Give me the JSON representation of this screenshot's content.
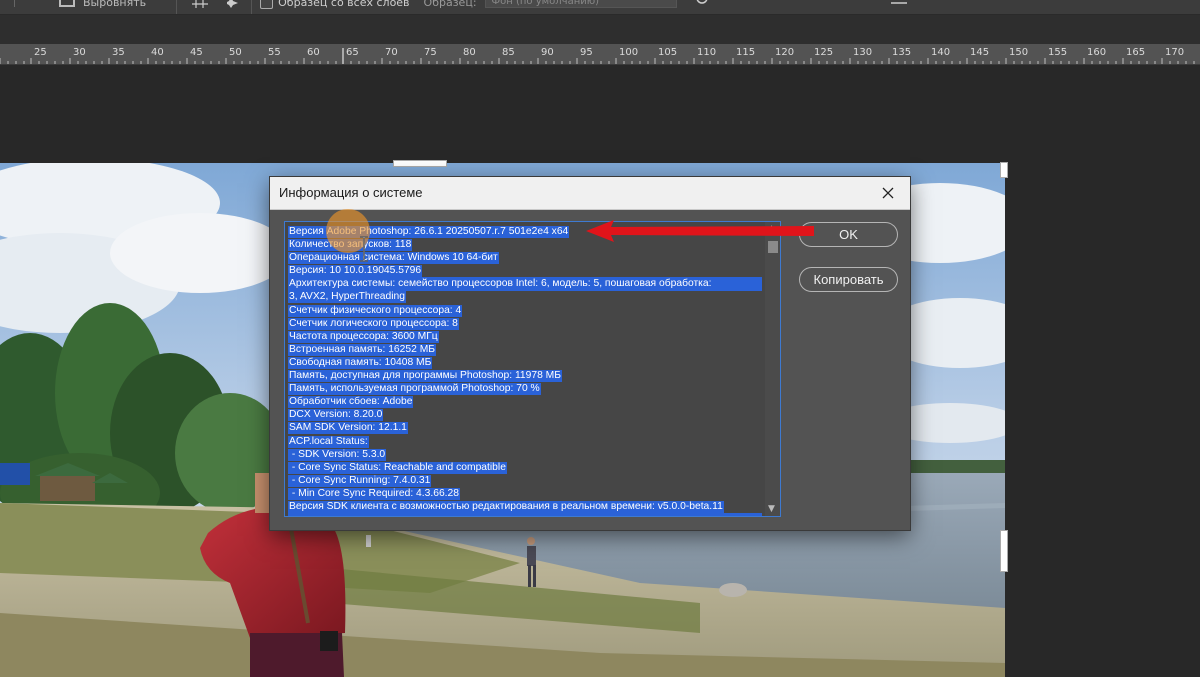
{
  "options_bar": {
    "align_label": "Выровнять",
    "sample_all_layers_label": "Образец со всех слоев",
    "sample_label": "Образец:",
    "sample_value": "Фон (по умолчанию)"
  },
  "ruler": {
    "ticks": [
      "25",
      "30",
      "35",
      "40",
      "45",
      "50",
      "55",
      "60",
      "65",
      "70",
      "75",
      "80",
      "85",
      "90",
      "95",
      "100",
      "105",
      "110",
      "115",
      "120",
      "125",
      "130",
      "135",
      "140",
      "145",
      "150",
      "155",
      "160",
      "165",
      "170"
    ]
  },
  "dialog": {
    "title": "Информация о системе",
    "ok_label": "OK",
    "copy_label": "Копировать",
    "lines": [
      "Версия Adobe Photoshop: 26.6.1 20250507.r.7 501e2e4  x64",
      "Количество запусков: 118",
      "Операционная система: Windows 10 64-бит",
      "Версия: 10 10.0.19045.5796",
      "Архитектура системы: семейство процессоров Intel: 6, модель: 5, пошаговая обработка:",
      "3, AVX2, HyperThreading",
      "Счетчик физического процессора: 4",
      "Счетчик логического процессора: 8",
      "Частота процессора: 3600 МГц",
      "Встроенная память: 16252 МБ",
      "Свободная память: 10408 МБ",
      "Память, доступная для программы Photoshop: 11978 МБ",
      "Память, используемая программой Photoshop: 70 %",
      "Обработчик сбоев: Adobe",
      "DCX Version: 8.20.0",
      "SAM SDK Version: 12.1.1",
      "ACP.local Status:",
      " - SDK Version: 5.3.0",
      " - Core Sync Status: Reachable and compatible",
      " - Core Sync Running: 7.4.0.31",
      " - Min Core Sync Required: 4.3.66.28",
      "Версия SDK клиента с возможностью редактирования в реальном времени: v5.0.0-beta.11"
    ]
  },
  "colors": {
    "selection": "#2a62d8",
    "annotation_arrow": "#e0141a",
    "cursor_highlight": "#f0962a"
  }
}
